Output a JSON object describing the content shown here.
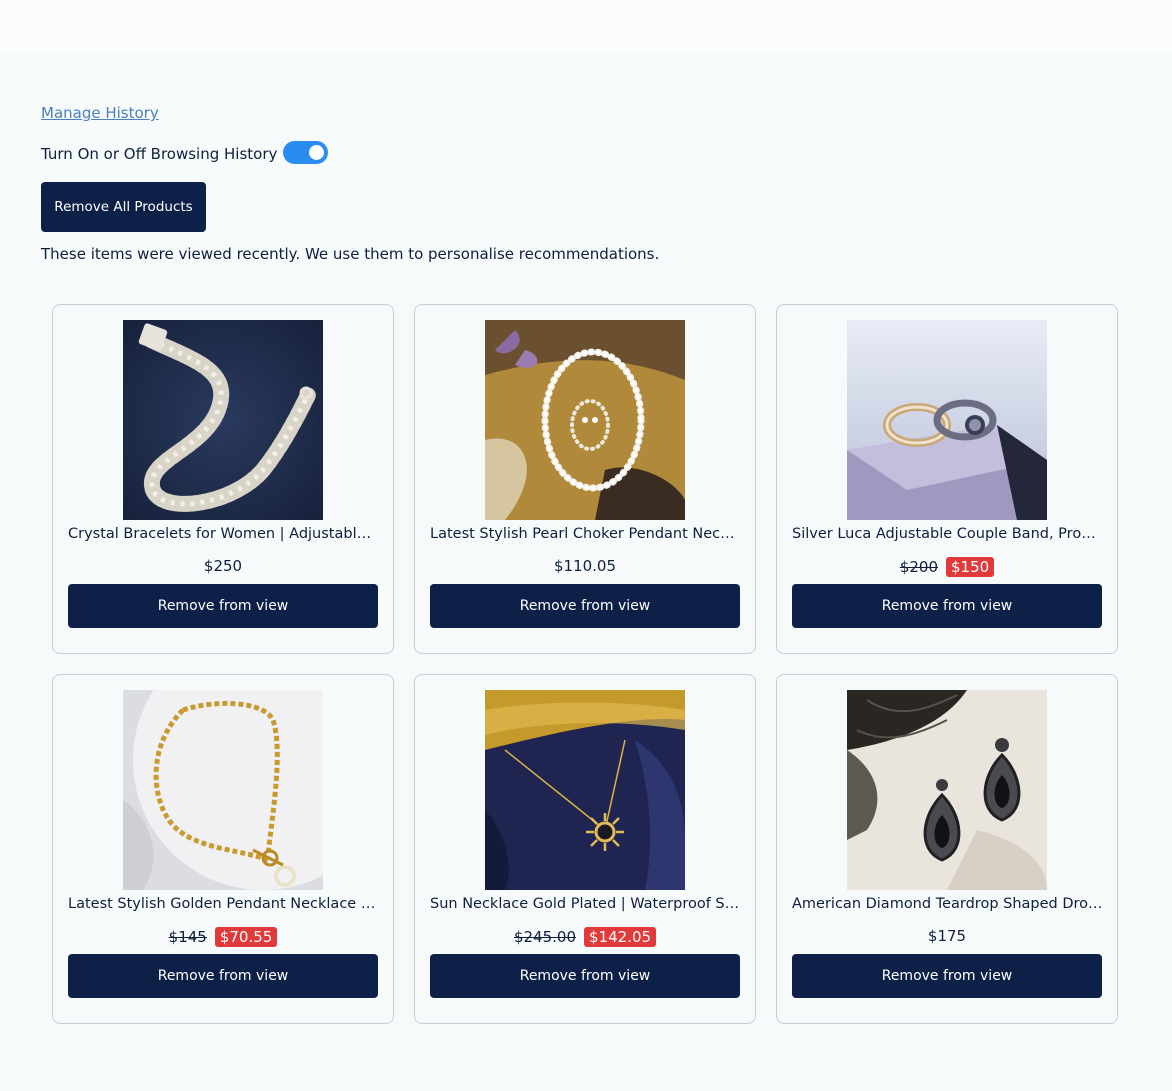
{
  "history": {
    "manage_link": "Manage History",
    "toggle_label": "Turn On or Off Browsing History",
    "toggle_on": true,
    "remove_all_label": "Remove All Products",
    "note": "These items were viewed recently. We use them to personalise recommendations."
  },
  "products": [
    {
      "name": "Crystal Bracelets for Women | Adjustable Crystal Bracelet",
      "price": "$250",
      "old_price": "",
      "sale_price": "",
      "image": "silver-chain-bracelet",
      "button_label": "Remove from view"
    },
    {
      "name": "Latest Stylish Pearl Choker Pendant Necklace",
      "price": "$110.05",
      "old_price": "",
      "sale_price": "",
      "image": "pearl-necklace-set",
      "button_label": "Remove from view"
    },
    {
      "name": "Silver Luca Adjustable Couple Band, Promise Rings",
      "price": "",
      "old_price": "$200",
      "sale_price": "$150",
      "image": "couple-rings",
      "button_label": "Remove from view"
    },
    {
      "name": "Latest Stylish Golden Pendant Necklace for Women",
      "price": "",
      "old_price": "$145",
      "sale_price": "$70.55",
      "image": "golden-chain-necklace",
      "button_label": "Remove from view"
    },
    {
      "name": "Sun Necklace Gold Plated | Waterproof Sun Pendant",
      "price": "",
      "old_price": "$245.00",
      "sale_price": "$142.05",
      "image": "sun-pendant-necklace",
      "button_label": "Remove from view"
    },
    {
      "name": "American Diamond Teardrop Shaped Drop Earrings",
      "price": "$175",
      "old_price": "",
      "sale_price": "",
      "image": "teardrop-earrings",
      "button_label": "Remove from view"
    }
  ],
  "colors": {
    "primary": "#0d2148",
    "toggle": "#2a8cf0",
    "sale": "#e23a3a",
    "link": "#4a7fc1"
  }
}
